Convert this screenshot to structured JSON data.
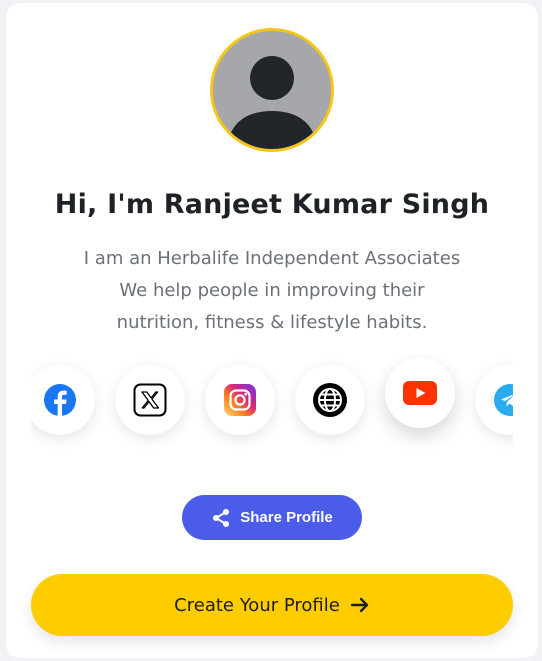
{
  "profile": {
    "name": "Hi, I'm Ranjeet Kumar Singh",
    "bio_lines": [
      "I am an Herbalife Independent Associates",
      "We help people in improving their",
      "nutrition, fitness & lifestyle habits."
    ],
    "avatar_icon": "user-silhouette-icon"
  },
  "social_links": [
    {
      "icon": "facebook-icon",
      "color": "#1877f2"
    },
    {
      "icon": "x-icon",
      "color": "#000000"
    },
    {
      "icon": "instagram-icon",
      "color": "#dd2a7b"
    },
    {
      "icon": "globe-icon",
      "color": "#000000"
    },
    {
      "icon": "youtube-icon",
      "color": "#ff3300"
    },
    {
      "icon": "telegram-icon",
      "color": "#2aabee"
    }
  ],
  "actions": {
    "share_label": "Share Profile",
    "share_icon": "share-icon",
    "create_label": "Create Your Profile",
    "create_icon": "arrow-right-icon"
  },
  "colors": {
    "accent": "#ffcc00",
    "share_button": "#4a5ce8",
    "avatar_ring": "#f5c518"
  }
}
